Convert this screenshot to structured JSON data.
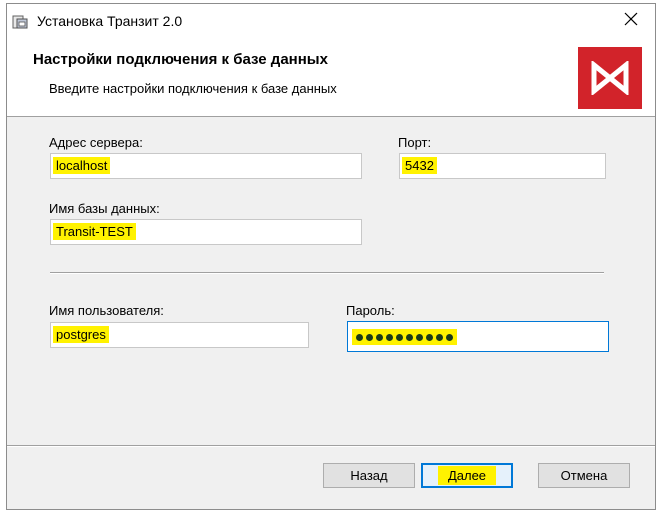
{
  "window": {
    "title": "Установка Транзит 2.0"
  },
  "header": {
    "title": "Настройки подключения к базе данных",
    "subtitle": "Введите настройки подключения к базе данных"
  },
  "form": {
    "server_label": "Адрес сервера:",
    "server_value": "localhost",
    "port_label": "Порт:",
    "port_value": "5432",
    "db_label": "Имя базы данных:",
    "db_value": "Transit-TEST",
    "user_label": "Имя пользователя:",
    "user_value": "postgres",
    "password_label": "Пароль:",
    "password_masked_count": 10
  },
  "buttons": {
    "back": "Назад",
    "next": "Далее",
    "cancel": "Отмена"
  },
  "colors": {
    "highlight": "#fff200",
    "logo_red": "#d2232a",
    "focus_blue": "#0078d7"
  }
}
